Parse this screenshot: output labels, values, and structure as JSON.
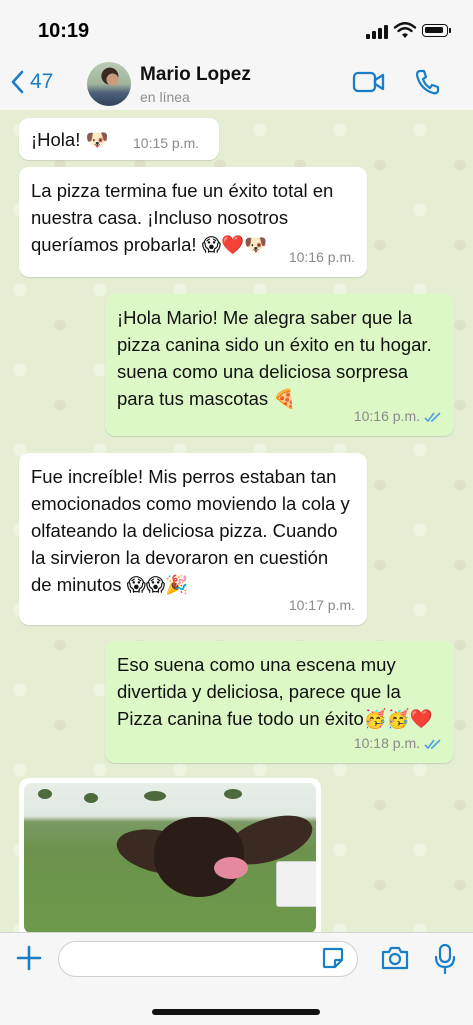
{
  "status_bar": {
    "time": "10:19"
  },
  "header": {
    "back_count": "47",
    "contact_name": "Mario Lopez",
    "contact_status": "en línea"
  },
  "messages": [
    {
      "direction": "in",
      "text": "¡Hola! 🐶",
      "time": "10:15 p.m."
    },
    {
      "direction": "in",
      "text": "La pizza termina fue un éxito total en nuestra casa. ¡Incluso nosotros queríamos probarla! 😱❤️🐶",
      "time": "10:16 p.m."
    },
    {
      "direction": "out",
      "text": "¡Hola Mario! Me alegra saber que la pizza canina sido un éxito en tu hogar. suena como una deliciosa sorpresa para tus mascotas 🍕",
      "time": "10:16 p.m."
    },
    {
      "direction": "in",
      "text": "Fue increíble! Mis perros estaban tan emocionados como moviendo la cola y olfateando la deliciosa pizza. Cuando la sirvieron la devoraron en cuestión de minutos 😱😱🎉",
      "time": "10:17 p.m."
    },
    {
      "direction": "out",
      "text": "Eso suena como una escena muy divertida y deliciosa, parece que la Pizza canina fue todo un éxito🥳🥳❤️",
      "time": "10:18 p.m."
    }
  ],
  "colors": {
    "accent": "#1a7ec7",
    "incoming_bubble": "#ffffff",
    "outgoing_bubble": "#dbf8c6",
    "read_ticks": "#4aa3e0"
  },
  "icons": {
    "back": "chevron-left-icon",
    "video": "video-camera-icon",
    "call": "phone-icon",
    "plus": "plus-icon",
    "sticker": "sticker-icon",
    "camera": "camera-icon",
    "mic": "microphone-icon"
  }
}
